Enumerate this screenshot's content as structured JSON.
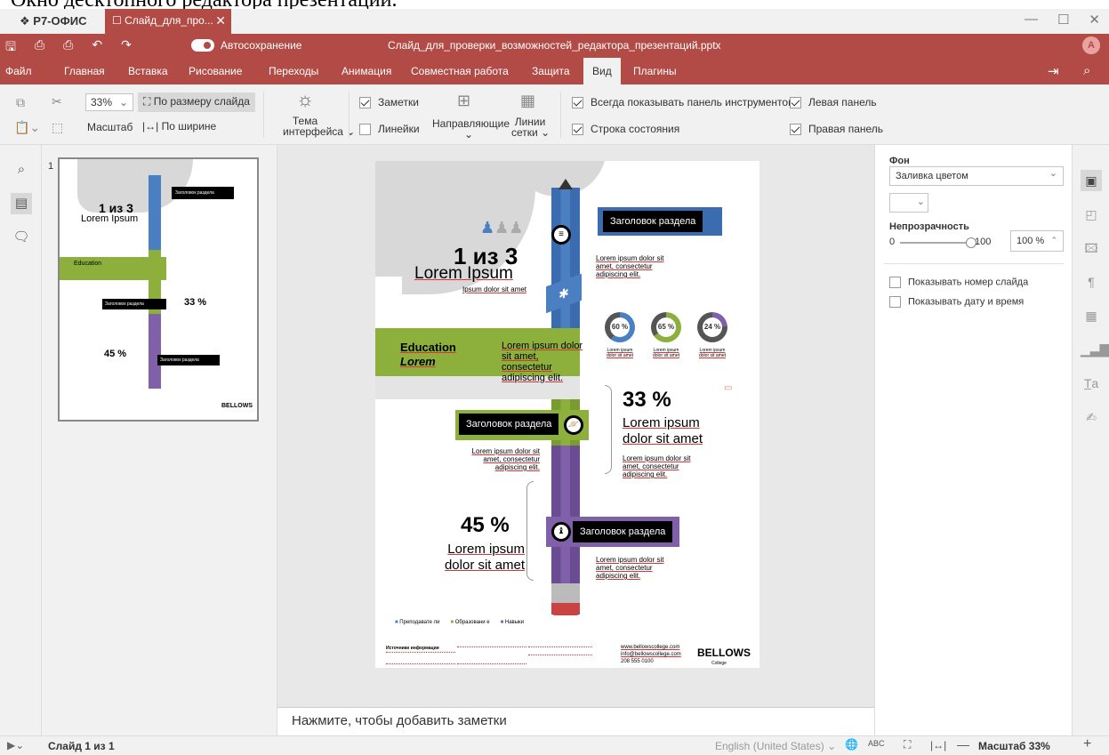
{
  "caption": "Окно десктопного редактора презентаций.",
  "app": {
    "brand": "Р7-ОФИС",
    "tab_title": "Слайд_для_про..."
  },
  "quickbar": {
    "autosave": "Автосохранение",
    "doc_title": "Слайд_для_проверки_возможностей_редактора_презентаций.pptx",
    "avatar": "А"
  },
  "menu": {
    "items": [
      "Файл",
      "Главная",
      "Вставка",
      "Рисование",
      "Переходы",
      "Анимация",
      "Совместная работа",
      "Защита",
      "Вид",
      "Плагины"
    ],
    "active": "Вид"
  },
  "ribbon": {
    "zoom_value": "33%",
    "fit_slide": "По размеру слайда",
    "zoom_label": "Масштаб",
    "fit_width": "По ширине",
    "theme_line1": "Тема",
    "theme_line2": "интерфейса",
    "notes": "Заметки",
    "rulers": "Линейки",
    "guides": "Направляющие",
    "grid_line1": "Линии",
    "grid_line2": "сетки",
    "always_toolbar": "Всегда показывать панель инструментов",
    "status_bar": "Строка состояния",
    "left_panel": "Левая панель",
    "right_panel": "Правая панель"
  },
  "thumbs": {
    "slide_number": "1"
  },
  "slide": {
    "section_header": "Заголовок раздела",
    "big_stat": "1 из 3",
    "lorem": "Lorem Ipsum",
    "lorem_sub": "Ipsum dolor sit amet",
    "body_text": "Lorem ipsum dolor sit amet, consectetur adipiscing elit.",
    "education": "Education",
    "education_sub": "Lorem",
    "edu_text": "Lorem ipsum dolor sit amet, consectetur adipiscing elit.",
    "donuts": [
      {
        "label": "60 %",
        "value": 60,
        "color": "#4a7fc1"
      },
      {
        "label": "65 %",
        "value": 65,
        "color": "#8db03d"
      },
      {
        "label": "24 %",
        "value": 24,
        "color": "#8060a8"
      }
    ],
    "donut_caption": "Lorem ipsum dolor sit amet",
    "stat33": "33 %",
    "stat33_text": "Lorem ipsum dolor sit amet",
    "stat45": "45 %",
    "stat45_text": "Lorem ipsum dolor sit amet",
    "legend": [
      "Преподавате ли",
      "Образовани е",
      "Навыки"
    ],
    "sources_title": "Источники информации",
    "site": "www.bellowscollege.com",
    "email": "info@bellowscollege.com",
    "phone": "208 555 0100",
    "logo": "BELLOWS",
    "logo_sub": "College"
  },
  "notes_placeholder": "Нажмите, чтобы добавить заметки",
  "rpanel": {
    "bg_label": "Фон",
    "fill_type": "Заливка цветом",
    "opacity_label": "Непрозрачность",
    "opacity_min": "0",
    "opacity_max": "100",
    "opacity_value": "100 %",
    "opacity_fraction": 1.0,
    "show_number": "Показывать номер слайда",
    "show_date": "Показывать дату и время"
  },
  "status": {
    "slide_counter": "Слайд 1 из 1",
    "language": "English (United States)",
    "zoom": "Масштаб 33%"
  }
}
